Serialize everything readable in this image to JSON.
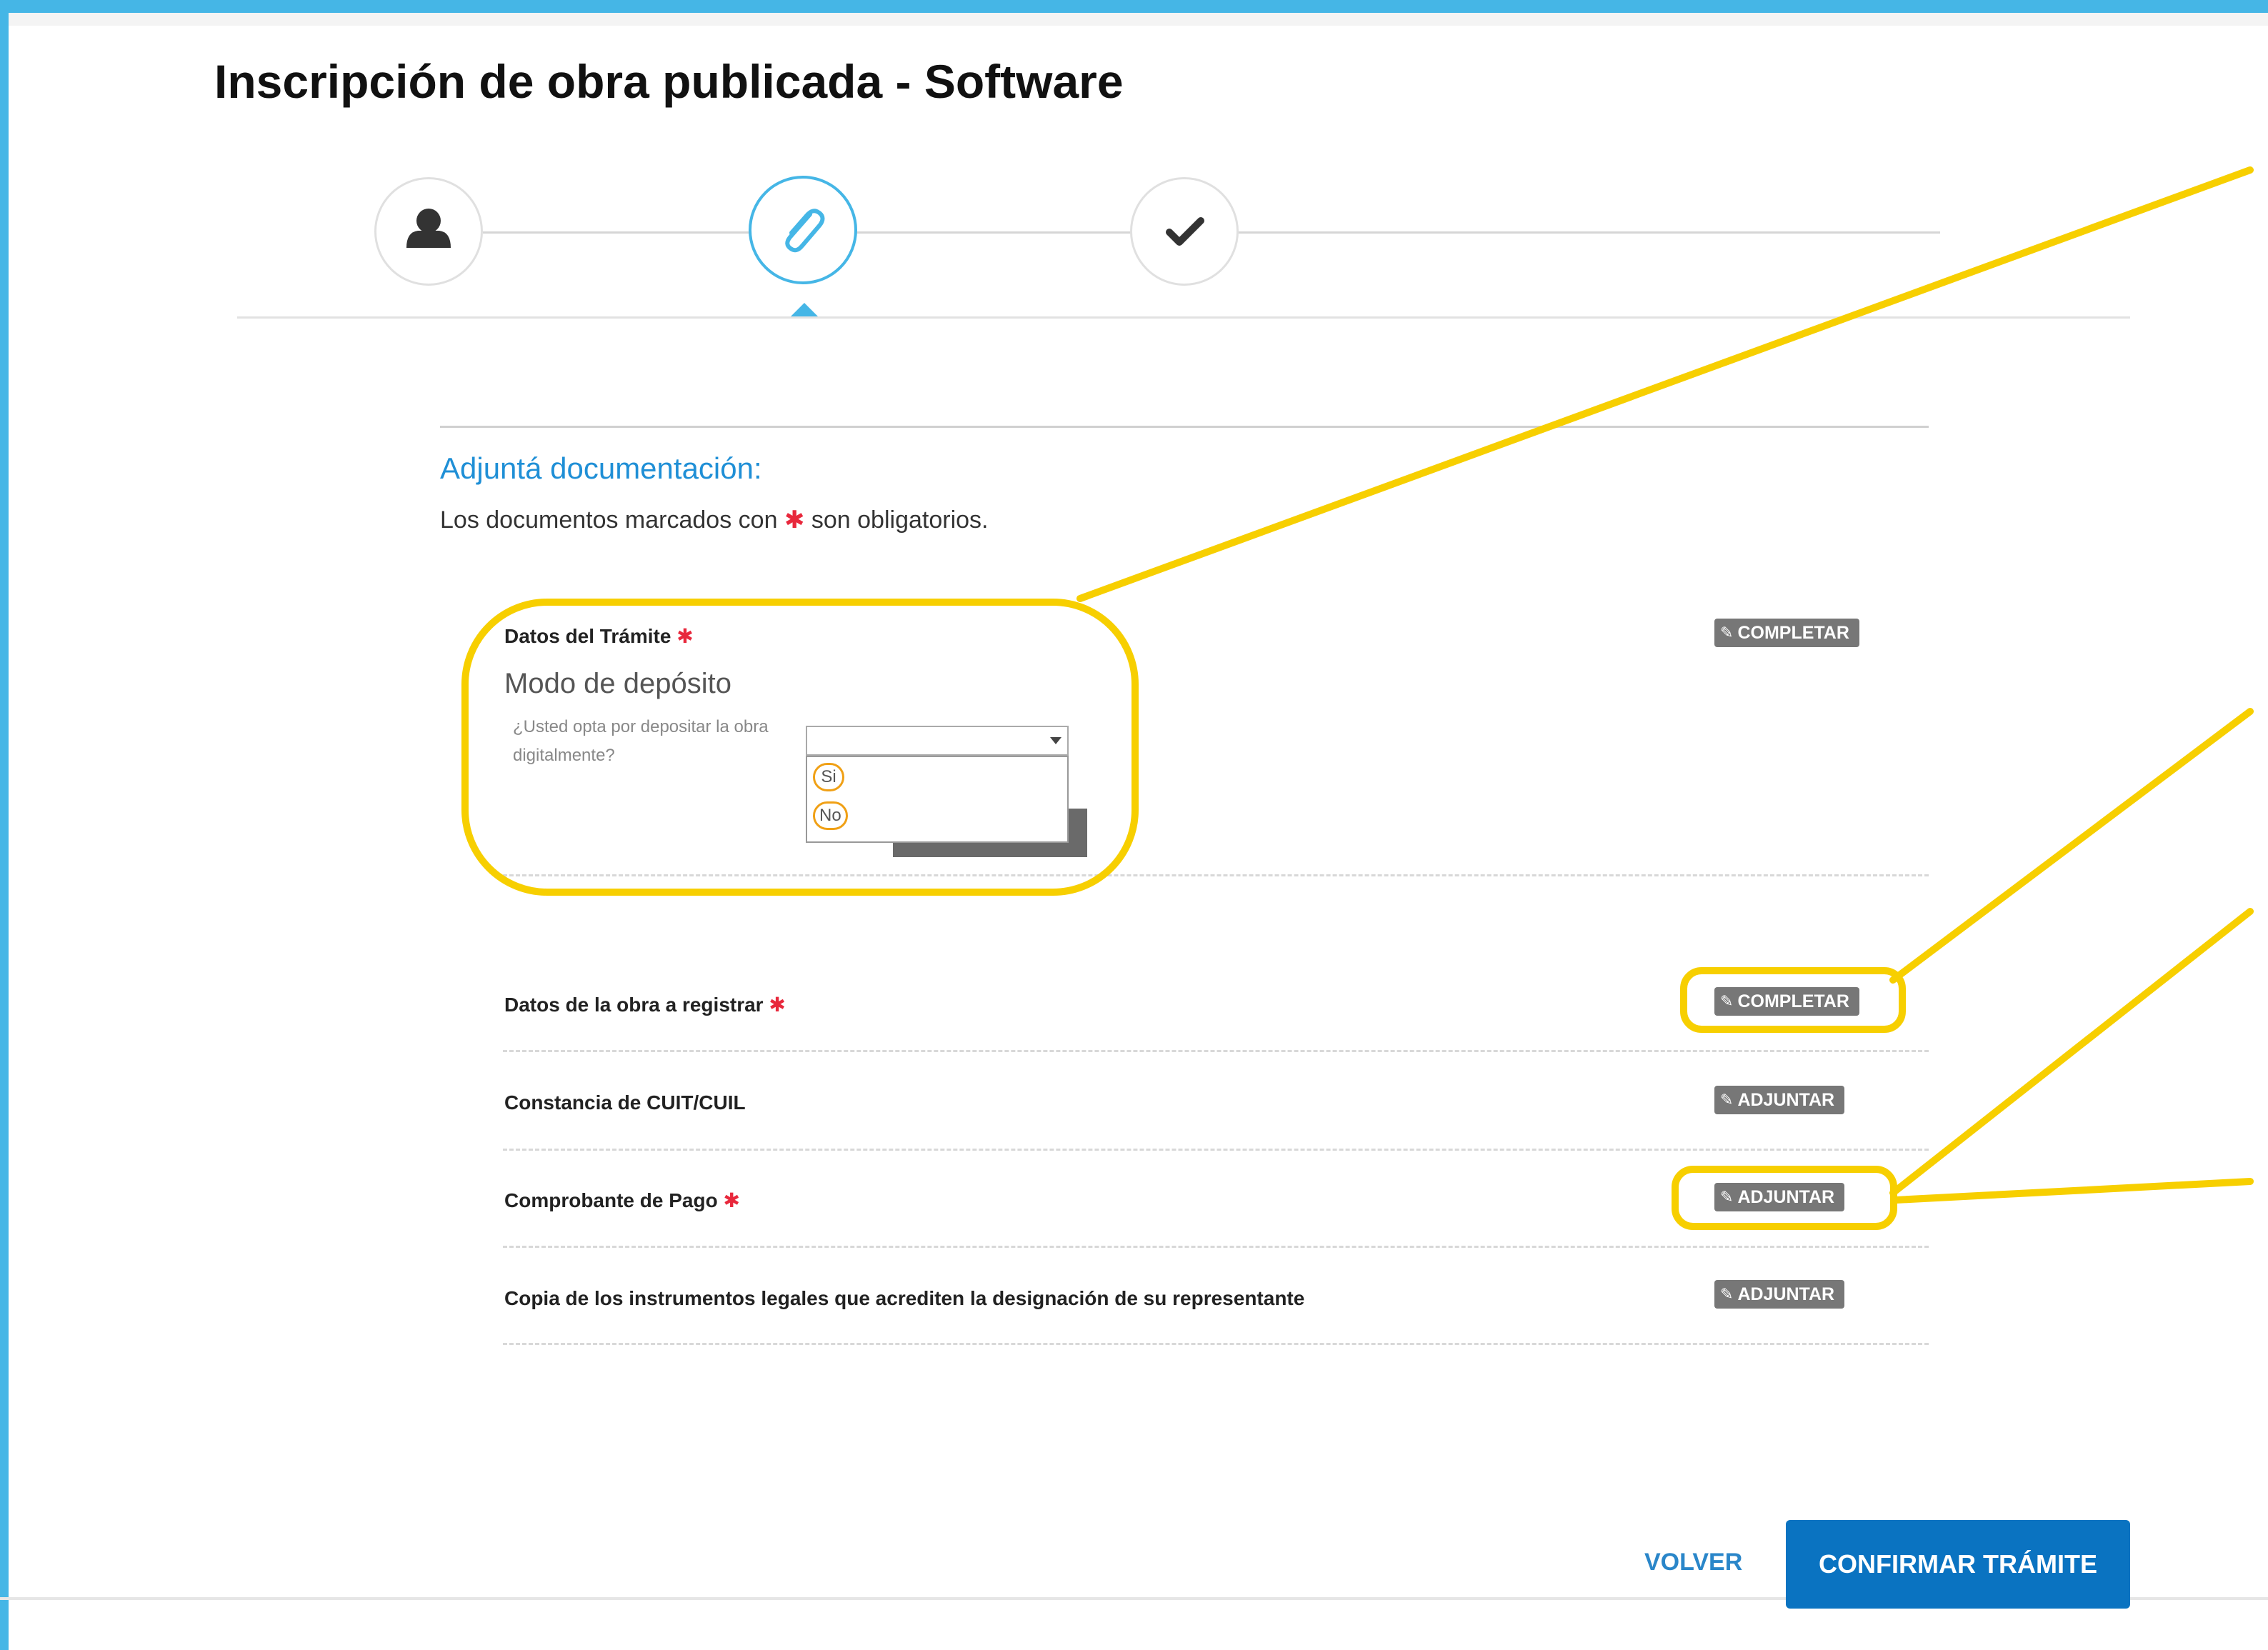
{
  "page": {
    "title": "Inscripción de obra publicada - Software"
  },
  "stepper": {
    "active_step": 2,
    "steps": [
      {
        "icon": "user-icon"
      },
      {
        "icon": "paperclip-icon"
      },
      {
        "icon": "check-icon"
      }
    ]
  },
  "section": {
    "title": "Adjuntá documentación:",
    "note_before": "Los documentos marcados con ",
    "note_asterisk": "✱",
    "note_after": " son obligatorios."
  },
  "documents": [
    {
      "label": "Datos del Trámite",
      "required": "✱",
      "action": "COMPLETAR",
      "action_icon": "pencil-icon"
    },
    {
      "label": "Datos de la obra a registrar",
      "required": "✱",
      "action": "COMPLETAR",
      "action_icon": "pencil-icon"
    },
    {
      "label": "Constancia de CUIT/CUIL",
      "required": "",
      "action": "ADJUNTAR",
      "action_icon": "paperclip-icon"
    },
    {
      "label": "Comprobante de Pago",
      "required": "✱",
      "action": "ADJUNTAR",
      "action_icon": "paperclip-icon"
    },
    {
      "label": "Copia de los instrumentos legales que acrediten la designación de su representante",
      "required": "",
      "action": "ADJUNTAR",
      "action_icon": "paperclip-icon"
    }
  ],
  "deposit": {
    "title": "Modo de depósito",
    "question": "¿Usted opta por depositar la obra digitalmente?",
    "selected_value": "",
    "options": [
      "Si",
      "No"
    ]
  },
  "footer": {
    "back_label": "VOLVER",
    "confirm_label": "CONFIRMAR TRÁMITE"
  },
  "colors": {
    "accent": "#45b6e6",
    "link": "#2a86c9",
    "primary_button": "#0a73c1",
    "required": "#e8283c",
    "highlight": "#f7cf00",
    "action_button": "#777777"
  }
}
